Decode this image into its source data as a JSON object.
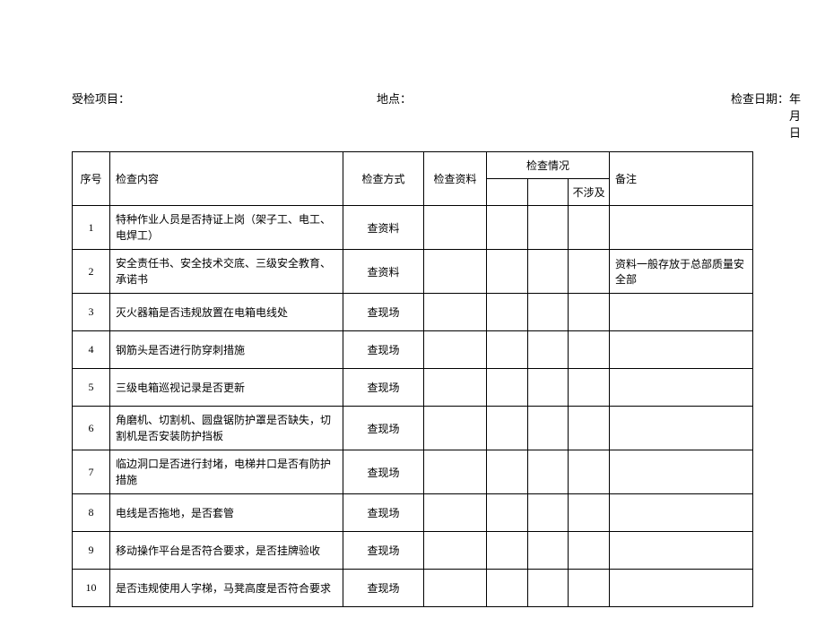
{
  "header": {
    "project_label": "受检项目：",
    "location_label": "地点：",
    "date_label": "检查日期：",
    "date_suffix": "年月日"
  },
  "columns": {
    "seq": "序号",
    "content": "检查内容",
    "method": "检查方式",
    "material": "检查资料",
    "situation": "检查情况",
    "situation_sub3": "不涉及",
    "remark": "备注"
  },
  "rows": [
    {
      "seq": "1",
      "content": "特种作业人员是否持证上岗（架子工、电工、电焊工）",
      "method": "查资料",
      "remark": ""
    },
    {
      "seq": "2",
      "content": "安全责任书、安全技术交底、三级安全教育、承诺书",
      "method": "查资料",
      "remark": "资料一般存放于总部质量安全部"
    },
    {
      "seq": "3",
      "content": "灭火器箱是否违规放置在电箱电线处",
      "method": "查现场",
      "remark": ""
    },
    {
      "seq": "4",
      "content": "钢筋头是否进行防穿刺措施",
      "method": "查现场",
      "remark": ""
    },
    {
      "seq": "5",
      "content": "三级电箱巡视记录是否更新",
      "method": "查现场",
      "remark": ""
    },
    {
      "seq": "6",
      "content": "角磨机、切割机、圆盘锯防护罩是否缺失，切割机是否安装防护挡板",
      "method": "查现场",
      "remark": ""
    },
    {
      "seq": "7",
      "content": "临边洞口是否进行封堵，电梯井口是否有防护措施",
      "method": "查现场",
      "remark": ""
    },
    {
      "seq": "8",
      "content": "电线是否拖地，是否套管",
      "method": "查现场",
      "remark": ""
    },
    {
      "seq": "9",
      "content": "移动操作平台是否符合要求，是否挂牌验收",
      "method": "查现场",
      "remark": ""
    },
    {
      "seq": "10",
      "content": "是否违规使用人字梯，马凳高度是否符合要求",
      "method": "查现场",
      "remark": ""
    }
  ]
}
